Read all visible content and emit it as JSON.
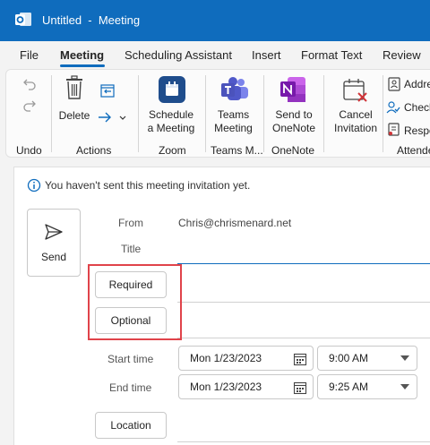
{
  "window": {
    "title": "Untitled  -  Meeting",
    "accent": "#0f6cbd",
    "app_icon": "outlook-icon"
  },
  "tabs": [
    {
      "label": "File"
    },
    {
      "label": "Meeting",
      "active": true
    },
    {
      "label": "Scheduling Assistant"
    },
    {
      "label": "Insert"
    },
    {
      "label": "Format Text"
    },
    {
      "label": "Review"
    }
  ],
  "ribbon": {
    "undo_group": "Undo",
    "actions": {
      "delete_label": "Delete",
      "group": "Actions"
    },
    "zoom": {
      "button_line1": "Schedule",
      "button_line2": "a Meeting",
      "group": "Zoom"
    },
    "teams": {
      "button_line1": "Teams",
      "button_line2": "Meeting",
      "group": "Teams M..."
    },
    "onenote": {
      "button_line1": "Send to",
      "button_line2": "OneNote",
      "group": "OneNote"
    },
    "cancel": {
      "button_line1": "Cancel",
      "button_line2": "Invitation"
    },
    "attendees": {
      "address": "Addre",
      "check": "Check",
      "response": "Respo",
      "group": "Attende"
    }
  },
  "form": {
    "info": "You haven't sent this meeting invitation yet.",
    "send_label": "Send",
    "from_label": "From",
    "from_value": "Chris@chrismenard.net",
    "title_label": "Title",
    "required_label": "Required",
    "optional_label": "Optional",
    "start_label": "Start time",
    "start_date": "Mon 1/23/2023",
    "start_time": "9:00 AM",
    "end_label": "End time",
    "end_date": "Mon 1/23/2023",
    "end_time": "9:25 AM",
    "location_label": "Location"
  }
}
